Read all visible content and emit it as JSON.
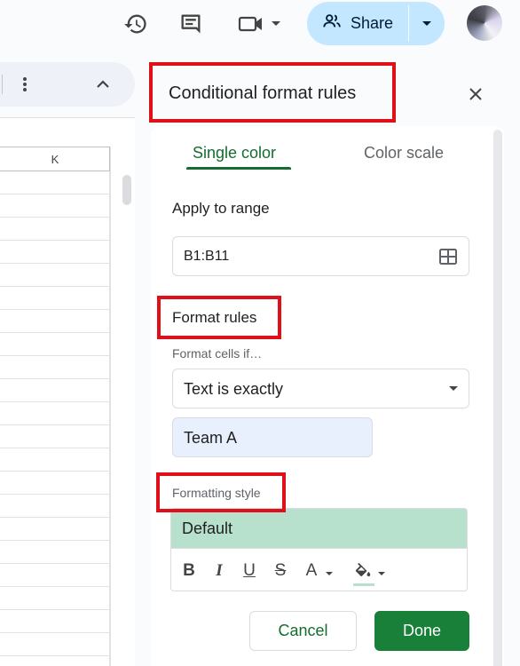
{
  "toolbar": {
    "history_icon": "history-icon",
    "comment_icon": "comment-icon",
    "meet_icon": "video-camera-icon",
    "share_label": "Share",
    "share_icon": "people-icon"
  },
  "sheet": {
    "column_label": "K"
  },
  "panel": {
    "title": "Conditional format rules",
    "tabs": [
      {
        "label": "Single color",
        "active": true
      },
      {
        "label": "Color scale",
        "active": false
      }
    ],
    "apply_to_range_label": "Apply to range",
    "range_value": "B1:B11",
    "format_rules_label": "Format rules",
    "format_cells_if_label": "Format cells if…",
    "condition": "Text is exactly",
    "condition_value": "Team A",
    "formatting_style_label": "Formatting style",
    "style_preview": "Default",
    "style_fill_color": "#b7e1cd",
    "format_buttons": {
      "bold": "B",
      "italic": "I",
      "underline": "U",
      "strikethrough": "S",
      "text_color": "A"
    },
    "cancel_label": "Cancel",
    "done_label": "Done"
  },
  "colors": {
    "accent_green": "#146c2e",
    "done_green": "#188038",
    "share_bg": "#c2e7ff",
    "highlight_red": "#e0101a"
  }
}
